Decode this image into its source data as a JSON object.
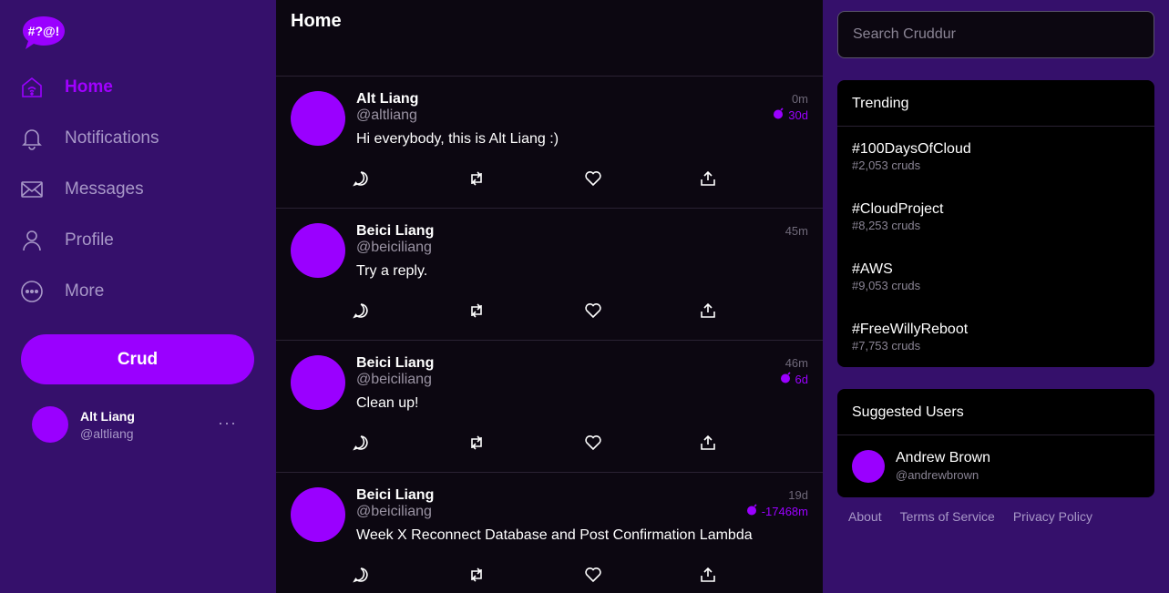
{
  "logo": {
    "text": "#?@!"
  },
  "nav": [
    {
      "label": "Home",
      "icon": "home-icon",
      "active": true
    },
    {
      "label": "Notifications",
      "icon": "bell-icon"
    },
    {
      "label": "Messages",
      "icon": "envelope-icon"
    },
    {
      "label": "Profile",
      "icon": "user-icon"
    },
    {
      "label": "More",
      "icon": "more-circle-icon"
    }
  ],
  "crud_button": {
    "label": "Crud"
  },
  "current_user": {
    "name": "Alt Liang",
    "handle": "@altliang",
    "menu": "···"
  },
  "feed": {
    "title": "Home",
    "posts": [
      {
        "name": "Alt Liang",
        "handle": "@altliang",
        "text": "Hi everybody, this is Alt Liang :)",
        "time": "0m",
        "expires": "30d"
      },
      {
        "name": "Beici Liang",
        "handle": "@beiciliang",
        "text": "Try a reply.",
        "time": "45m",
        "expires": ""
      },
      {
        "name": "Beici Liang",
        "handle": "@beiciliang",
        "text": "Clean up!",
        "time": "46m",
        "expires": "6d"
      },
      {
        "name": "Beici Liang",
        "handle": "@beiciliang",
        "text": "Week X Reconnect Database and Post Confirmation Lambda",
        "time": "19d",
        "expires": "-17468m"
      }
    ]
  },
  "search": {
    "placeholder": "Search Cruddur",
    "value": ""
  },
  "trending": {
    "title": "Trending",
    "items": [
      {
        "name": "#100DaysOfCloud",
        "count": "#2,053 cruds"
      },
      {
        "name": "#CloudProject",
        "count": "#8,253 cruds"
      },
      {
        "name": "#AWS",
        "count": "#9,053 cruds"
      },
      {
        "name": "#FreeWillyReboot",
        "count": "#7,753 cruds"
      }
    ]
  },
  "suggested": {
    "title": "Suggested Users",
    "users": [
      {
        "name": "Andrew Brown",
        "handle": "@andrewbrown"
      }
    ]
  },
  "footer": {
    "about": "About",
    "terms": "Terms of Service",
    "privacy": "Privacy Policy"
  },
  "colors": {
    "accent": "#9a00ff",
    "sidebar": "#35106b",
    "feed_bg": "#0c0711",
    "panel": "#000000"
  }
}
